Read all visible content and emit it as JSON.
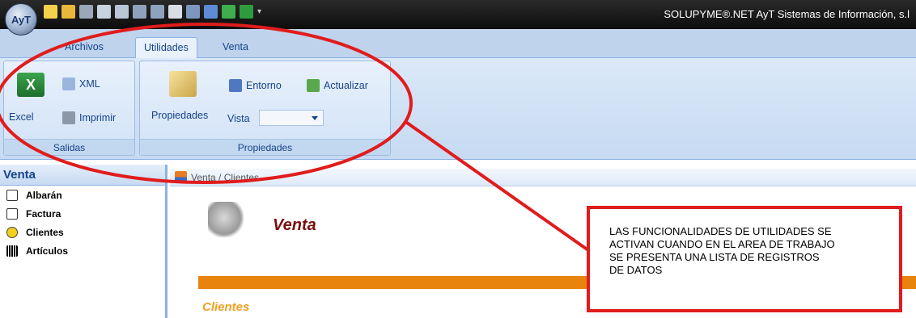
{
  "window": {
    "app_button_label": "AyT",
    "title": "SOLUPYME®.NET AyT Sistemas de Información, s.l"
  },
  "quick_access_icons": [
    "new-icon",
    "open-icon",
    "delete-icon",
    "grid-icon",
    "grid-icon-2",
    "undo-icon",
    "redo-icon",
    "save-icon",
    "edit-icon",
    "chart-icon",
    "doc-icon",
    "excel-icon",
    "dropdown-icon"
  ],
  "tabs": [
    {
      "label": "Archivos"
    },
    {
      "label": "Utilidades"
    },
    {
      "label": "Venta"
    }
  ],
  "ribbon": {
    "salidas": {
      "label": "Salidas",
      "excel": "Excel",
      "xml": "XML",
      "imprimir": "Imprimir"
    },
    "propiedades": {
      "label": "Propiedades",
      "propiedades_btn": "Propiedades",
      "entorno": "Entorno",
      "actualizar": "Actualizar",
      "vista_label": "Vista",
      "vista_value": ""
    }
  },
  "left_pane": {
    "header": "Venta",
    "items": [
      {
        "label": "Albarán",
        "icon": "albaran-icon"
      },
      {
        "label": "Factura",
        "icon": "factura-icon"
      },
      {
        "label": "Clientes",
        "icon": "smiley-icon"
      },
      {
        "label": "Artículos",
        "icon": "barcode-icon"
      }
    ]
  },
  "workspace": {
    "tab_title": "Venta / Clientes",
    "page_title": "Venta",
    "section_title": "Clientes"
  },
  "annotation": {
    "text": "LAS FUNCIONALIDADES DE UTILIDADES SE\nACTIVAN CUANDO EN EL AREA DE TRABAJO\n SE PRESENTA UNA LISTA DE REGISTROS\nDE DATOS"
  },
  "colors": {
    "annotation_red": "#e01c1c",
    "orange_bar": "#e8830e",
    "venta_title": "#7a1010",
    "clientes_subtitle": "#f0a020"
  }
}
